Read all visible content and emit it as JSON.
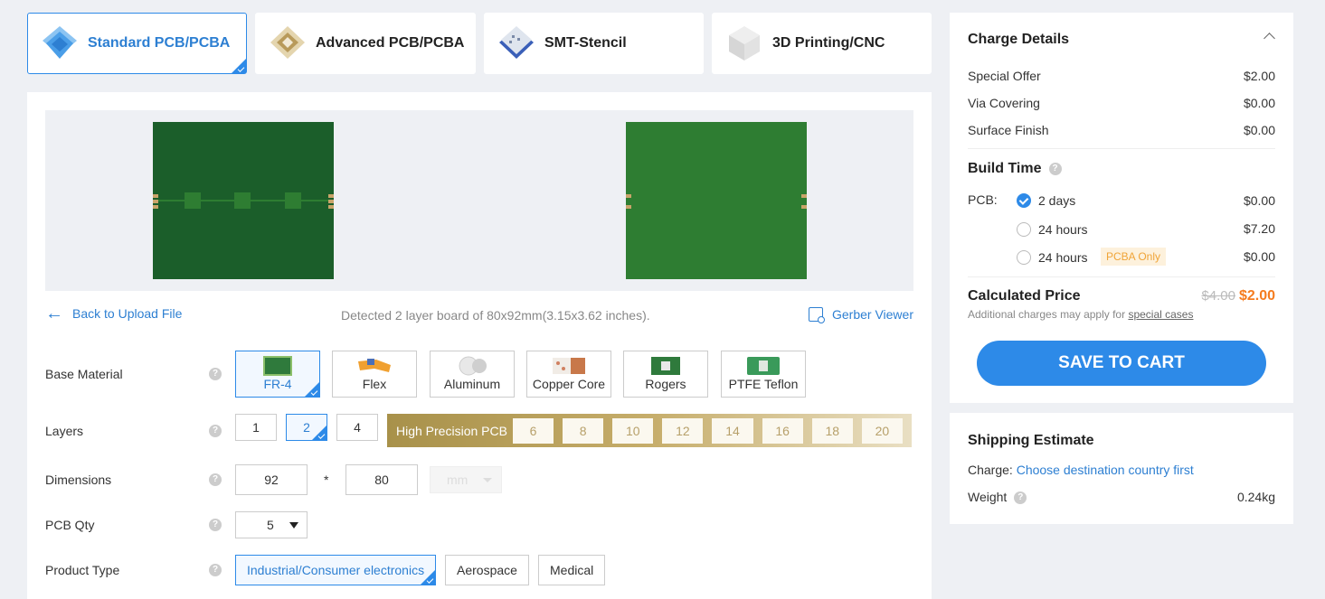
{
  "tabs": [
    {
      "label": "Standard PCB/PCBA",
      "icon": "standard-pcb-icon",
      "active": true
    },
    {
      "label": "Advanced PCB/PCBA",
      "icon": "advanced-pcb-icon",
      "active": false
    },
    {
      "label": "SMT-Stencil",
      "icon": "smt-stencil-icon",
      "active": false
    },
    {
      "label": "3D Printing/CNC",
      "icon": "3d-printing-icon",
      "active": false
    }
  ],
  "preview": {
    "back_label": "Back to Upload File",
    "detected_text": "Detected 2 layer board of 80x92mm(3.15x3.62 inches).",
    "gerber_label": "Gerber Viewer"
  },
  "form": {
    "base_material": {
      "label": "Base Material",
      "options": [
        "FR-4",
        "Flex",
        "Aluminum",
        "Copper Core",
        "Rogers",
        "PTFE Teflon"
      ],
      "selected": "FR-4"
    },
    "layers": {
      "label": "Layers",
      "options": [
        "1",
        "2",
        "4"
      ],
      "selected": "2",
      "high_precision_label": "High Precision PCB",
      "high_precision_options": [
        "6",
        "8",
        "10",
        "12",
        "14",
        "16",
        "18",
        "20"
      ]
    },
    "dimensions": {
      "label": "Dimensions",
      "height": "92",
      "separator": "*",
      "width": "80",
      "unit": "mm"
    },
    "pcb_qty": {
      "label": "PCB Qty",
      "value": "5"
    },
    "product_type": {
      "label": "Product Type",
      "options": [
        "Industrial/Consumer electronics",
        "Aerospace",
        "Medical"
      ],
      "selected": "Industrial/Consumer electronics"
    }
  },
  "charge_details": {
    "title": "Charge Details",
    "items": [
      {
        "label": "Special Offer",
        "value": "$2.00"
      },
      {
        "label": "Via Covering",
        "value": "$0.00"
      },
      {
        "label": "Surface Finish",
        "value": "$0.00"
      }
    ],
    "build_time": {
      "title": "Build Time",
      "pcb_label": "PCB:",
      "options": [
        {
          "label": "2 days",
          "price": "$0.00",
          "checked": true
        },
        {
          "label": "24 hours",
          "price": "$7.20",
          "checked": false
        },
        {
          "label": "24 hours",
          "price": "$0.00",
          "checked": false,
          "tag": "PCBA Only"
        }
      ]
    },
    "calculated_price": {
      "title": "Calculated Price",
      "old": "$4.00",
      "new": "$2.00",
      "note": "Additional charges may apply for",
      "note_link": "special cases"
    },
    "cart_button": "SAVE TO CART"
  },
  "shipping": {
    "title": "Shipping Estimate",
    "charge_label": "Charge:",
    "charge_link": "Choose destination country first",
    "weight_label": "Weight",
    "weight_value": "0.24kg"
  },
  "colors": {
    "accent": "#2d8ae8",
    "price_orange": "#f57c1f",
    "high_precision_gold": "#b7a06a"
  }
}
